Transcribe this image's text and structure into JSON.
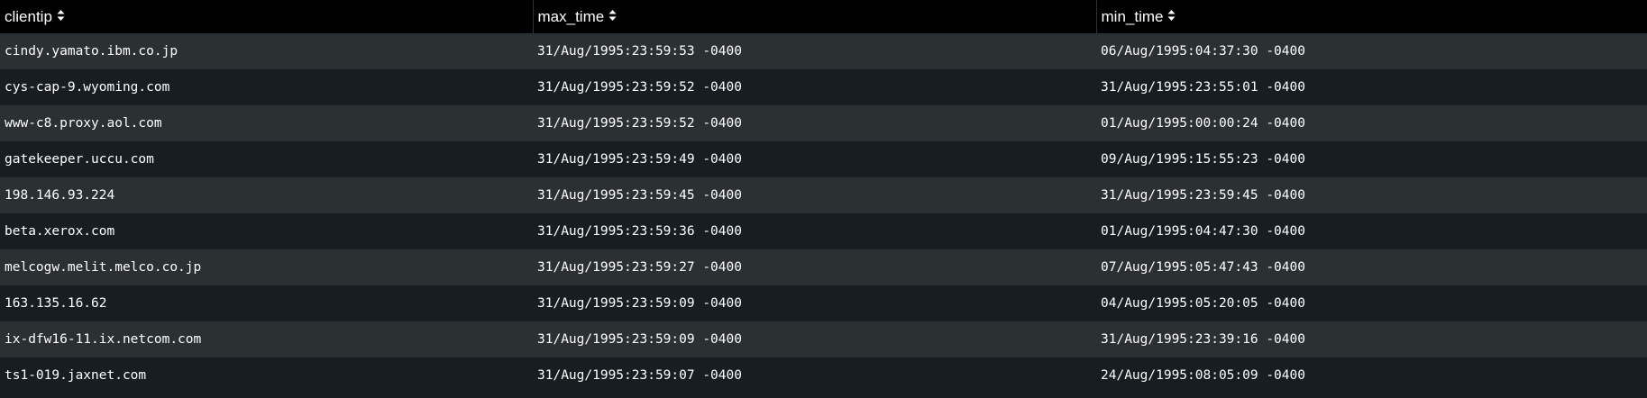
{
  "table": {
    "columns": [
      {
        "label": "clientip",
        "icon": "sort-icon"
      },
      {
        "label": "max_time",
        "icon": "sort-icon"
      },
      {
        "label": "min_time",
        "icon": "sort-icon"
      }
    ],
    "rows": [
      {
        "clientip": "cindy.yamato.ibm.co.jp",
        "max_time": "31/Aug/1995:23:59:53 -0400",
        "min_time": "06/Aug/1995:04:37:30 -0400"
      },
      {
        "clientip": "cys-cap-9.wyoming.com",
        "max_time": "31/Aug/1995:23:59:52 -0400",
        "min_time": "31/Aug/1995:23:55:01 -0400"
      },
      {
        "clientip": "www-c8.proxy.aol.com",
        "max_time": "31/Aug/1995:23:59:52 -0400",
        "min_time": "01/Aug/1995:00:00:24 -0400"
      },
      {
        "clientip": "gatekeeper.uccu.com",
        "max_time": "31/Aug/1995:23:59:49 -0400",
        "min_time": "09/Aug/1995:15:55:23 -0400"
      },
      {
        "clientip": "198.146.93.224",
        "max_time": "31/Aug/1995:23:59:45 -0400",
        "min_time": "31/Aug/1995:23:59:45 -0400"
      },
      {
        "clientip": "beta.xerox.com",
        "max_time": "31/Aug/1995:23:59:36 -0400",
        "min_time": "01/Aug/1995:04:47:30 -0400"
      },
      {
        "clientip": "melcogw.melit.melco.co.jp",
        "max_time": "31/Aug/1995:23:59:27 -0400",
        "min_time": "07/Aug/1995:05:47:43 -0400"
      },
      {
        "clientip": "163.135.16.62",
        "max_time": "31/Aug/1995:23:59:09 -0400",
        "min_time": "04/Aug/1995:05:20:05 -0400"
      },
      {
        "clientip": "ix-dfw16-11.ix.netcom.com",
        "max_time": "31/Aug/1995:23:59:09 -0400",
        "min_time": "31/Aug/1995:23:39:16 -0400"
      },
      {
        "clientip": "ts1-019.jaxnet.com",
        "max_time": "31/Aug/1995:23:59:07 -0400",
        "min_time": "24/Aug/1995:08:05:09 -0400"
      }
    ]
  }
}
